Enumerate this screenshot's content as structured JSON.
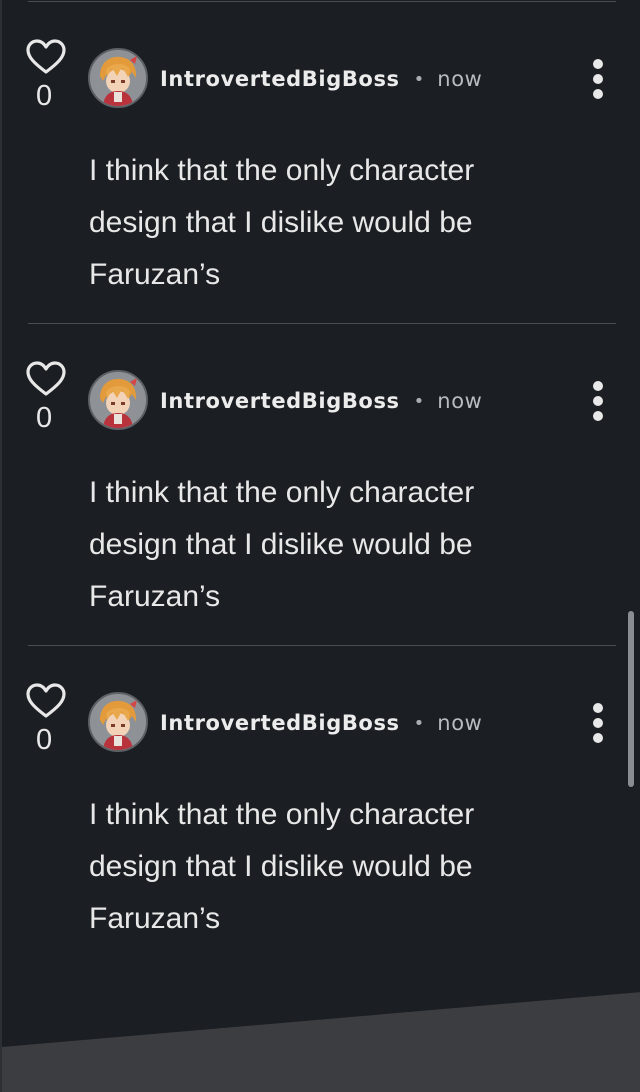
{
  "comments": [
    {
      "likes": "0",
      "username": "IntrovertedBigBoss",
      "separator": "•",
      "time": "now",
      "text": "I think that the only character design that I dislike would be Faruzan’s"
    },
    {
      "likes": "0",
      "username": "IntrovertedBigBoss",
      "separator": "•",
      "time": "now",
      "text": "I think that the only character design that I dislike would be Faruzan’s"
    },
    {
      "likes": "0",
      "username": "IntrovertedBigBoss",
      "separator": "•",
      "time": "now",
      "text": "I think that the only character design that I dislike would be Faruzan’s"
    }
  ],
  "icons": {
    "like": "heart-outline-icon",
    "more": "vertical-ellipsis-icon"
  },
  "colors": {
    "background": "#1b1e22",
    "divider": "#4a4d52",
    "text": "#e8e8e8",
    "muted": "#b8bbbf"
  }
}
